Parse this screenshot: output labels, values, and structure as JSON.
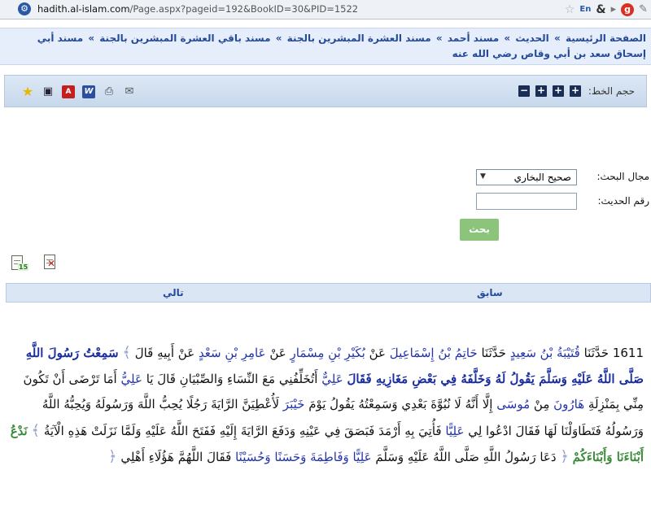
{
  "browser": {
    "url_domain": "hadith.al-islam.com",
    "url_path": "/Page.aspx?pageid=192&BookID=30&PID=1522",
    "lang_badge": "En"
  },
  "breadcrumb": {
    "items": [
      "الصفحة الرئيسية",
      "الحديث",
      "مسند أحمد",
      "مسند العشرة المبشرين بالجنة",
      "مسند باقي العشرة المبشرين بالجنة",
      "مسند أبي إسحاق سعد بن أبي وقاص رضي الله عنه"
    ],
    "separator": "»"
  },
  "toolbar": {
    "font_size_label": "حجم الخط:",
    "icons": [
      "favorite-star-icon",
      "save-icon",
      "pdf-icon",
      "word-icon",
      "print-icon",
      "mail-icon"
    ]
  },
  "search": {
    "field_label": "مجال البحث:",
    "field_value": "صحيح البخاري",
    "number_label": "رقم الحديث:",
    "number_value": "",
    "button_label": "بحث"
  },
  "nav": {
    "prev_label": "سابق",
    "next_label": "تالي"
  },
  "hadith": {
    "number": "1611",
    "t1": "حَدَّثَنَا",
    "n1": "قُتَيْبَةُ بْنُ سَعِيدٍ",
    "t2": "حَدَّثَنَا",
    "n2": "حَاتِمُ بْنُ إِسْمَاعِيلَ",
    "t3": "عَنْ",
    "n3": "بُكَيْرِ بْنِ مِسْمَارٍ",
    "t4": "عَنْ",
    "n4": "عَامِرِ بْنِ سَعْدٍ",
    "t5": "عَنْ أَبِيهِ قَالَ",
    "p1": "سَمِعْتُ رَسُولَ اللَّهِ صَلَّى اللَّهُ عَلَيْهِ وَسَلَّمَ يَقُولُ لَهُ وَخَلَّفَهُ فِي بَعْضِ مَغَازِيهِ فَقَالَ",
    "n5": "عَلِيٌّ",
    "t6": "أَتُخَلِّفُنِي مَعَ النِّسَاءِ وَالصِّبْيَانِ قَالَ يَا",
    "n6": "عَلِيُّ",
    "t7": "أَمَا تَرْضَى أَنْ تَكُونَ مِنِّي بِمَنْزِلَةِ",
    "n7": "هَارُونَ",
    "t8": "مِنْ",
    "n8": "مُوسَى",
    "t9": "إِلَّا أَنَّهُ لَا نُبُوَّةَ بَعْدِي وَسَمِعْتُهُ يَقُولُ يَوْمَ",
    "n9": "خَيْبَرَ",
    "t10": "لَأُعْطِيَنَّ الرَّايَةَ رَجُلًا يُحِبُّ اللَّهَ وَرَسُولَهُ وَيُحِبُّهُ اللَّهُ وَرَسُولُهُ فَتَطَاوَلْنَا لَهَا فَقَالَ ادْعُوا لِي",
    "n10": "عَلِيًّا",
    "t11": "فَأُتِيَ بِهِ أَرْمَدَ فَبَصَقَ فِي عَيْنِهِ وَدَفَعَ الرَّايَةَ إِلَيْهِ فَفَتَحَ اللَّهُ عَلَيْهِ وَلَمَّا نَزَلَتْ هَذِهِ الْآيَةُ",
    "q1": "نَدْعُ أَبْنَاءَنَا وَأَبْنَاءَكُمْ",
    "t12": "دَعَا رَسُولُ اللَّهِ صَلَّى اللَّهُ عَلَيْهِ وَسَلَّمَ",
    "n11": "عَلِيًّا وَفَاطِمَةَ وَحَسَنًا وَحُسَيْنًا",
    "t13": "فَقَالَ اللَّهُمَّ هَؤُلَاءِ أَهْلِي",
    "orn_open": "﴿",
    "orn_close": "﴾"
  }
}
